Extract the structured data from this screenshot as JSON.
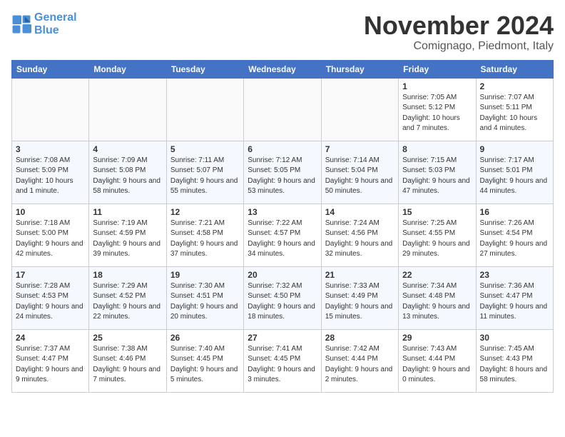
{
  "header": {
    "logo_text_general": "General",
    "logo_text_blue": "Blue",
    "month_title": "November 2024",
    "location": "Comignago, Piedmont, Italy"
  },
  "calendar": {
    "days_of_week": [
      "Sunday",
      "Monday",
      "Tuesday",
      "Wednesday",
      "Thursday",
      "Friday",
      "Saturday"
    ],
    "weeks": [
      [
        {
          "day": "",
          "info": ""
        },
        {
          "day": "",
          "info": ""
        },
        {
          "day": "",
          "info": ""
        },
        {
          "day": "",
          "info": ""
        },
        {
          "day": "",
          "info": ""
        },
        {
          "day": "1",
          "info": "Sunrise: 7:05 AM\nSunset: 5:12 PM\nDaylight: 10 hours and 7 minutes."
        },
        {
          "day": "2",
          "info": "Sunrise: 7:07 AM\nSunset: 5:11 PM\nDaylight: 10 hours and 4 minutes."
        }
      ],
      [
        {
          "day": "3",
          "info": "Sunrise: 7:08 AM\nSunset: 5:09 PM\nDaylight: 10 hours and 1 minute."
        },
        {
          "day": "4",
          "info": "Sunrise: 7:09 AM\nSunset: 5:08 PM\nDaylight: 9 hours and 58 minutes."
        },
        {
          "day": "5",
          "info": "Sunrise: 7:11 AM\nSunset: 5:07 PM\nDaylight: 9 hours and 55 minutes."
        },
        {
          "day": "6",
          "info": "Sunrise: 7:12 AM\nSunset: 5:05 PM\nDaylight: 9 hours and 53 minutes."
        },
        {
          "day": "7",
          "info": "Sunrise: 7:14 AM\nSunset: 5:04 PM\nDaylight: 9 hours and 50 minutes."
        },
        {
          "day": "8",
          "info": "Sunrise: 7:15 AM\nSunset: 5:03 PM\nDaylight: 9 hours and 47 minutes."
        },
        {
          "day": "9",
          "info": "Sunrise: 7:17 AM\nSunset: 5:01 PM\nDaylight: 9 hours and 44 minutes."
        }
      ],
      [
        {
          "day": "10",
          "info": "Sunrise: 7:18 AM\nSunset: 5:00 PM\nDaylight: 9 hours and 42 minutes."
        },
        {
          "day": "11",
          "info": "Sunrise: 7:19 AM\nSunset: 4:59 PM\nDaylight: 9 hours and 39 minutes."
        },
        {
          "day": "12",
          "info": "Sunrise: 7:21 AM\nSunset: 4:58 PM\nDaylight: 9 hours and 37 minutes."
        },
        {
          "day": "13",
          "info": "Sunrise: 7:22 AM\nSunset: 4:57 PM\nDaylight: 9 hours and 34 minutes."
        },
        {
          "day": "14",
          "info": "Sunrise: 7:24 AM\nSunset: 4:56 PM\nDaylight: 9 hours and 32 minutes."
        },
        {
          "day": "15",
          "info": "Sunrise: 7:25 AM\nSunset: 4:55 PM\nDaylight: 9 hours and 29 minutes."
        },
        {
          "day": "16",
          "info": "Sunrise: 7:26 AM\nSunset: 4:54 PM\nDaylight: 9 hours and 27 minutes."
        }
      ],
      [
        {
          "day": "17",
          "info": "Sunrise: 7:28 AM\nSunset: 4:53 PM\nDaylight: 9 hours and 24 minutes."
        },
        {
          "day": "18",
          "info": "Sunrise: 7:29 AM\nSunset: 4:52 PM\nDaylight: 9 hours and 22 minutes."
        },
        {
          "day": "19",
          "info": "Sunrise: 7:30 AM\nSunset: 4:51 PM\nDaylight: 9 hours and 20 minutes."
        },
        {
          "day": "20",
          "info": "Sunrise: 7:32 AM\nSunset: 4:50 PM\nDaylight: 9 hours and 18 minutes."
        },
        {
          "day": "21",
          "info": "Sunrise: 7:33 AM\nSunset: 4:49 PM\nDaylight: 9 hours and 15 minutes."
        },
        {
          "day": "22",
          "info": "Sunrise: 7:34 AM\nSunset: 4:48 PM\nDaylight: 9 hours and 13 minutes."
        },
        {
          "day": "23",
          "info": "Sunrise: 7:36 AM\nSunset: 4:47 PM\nDaylight: 9 hours and 11 minutes."
        }
      ],
      [
        {
          "day": "24",
          "info": "Sunrise: 7:37 AM\nSunset: 4:47 PM\nDaylight: 9 hours and 9 minutes."
        },
        {
          "day": "25",
          "info": "Sunrise: 7:38 AM\nSunset: 4:46 PM\nDaylight: 9 hours and 7 minutes."
        },
        {
          "day": "26",
          "info": "Sunrise: 7:40 AM\nSunset: 4:45 PM\nDaylight: 9 hours and 5 minutes."
        },
        {
          "day": "27",
          "info": "Sunrise: 7:41 AM\nSunset: 4:45 PM\nDaylight: 9 hours and 3 minutes."
        },
        {
          "day": "28",
          "info": "Sunrise: 7:42 AM\nSunset: 4:44 PM\nDaylight: 9 hours and 2 minutes."
        },
        {
          "day": "29",
          "info": "Sunrise: 7:43 AM\nSunset: 4:44 PM\nDaylight: 9 hours and 0 minutes."
        },
        {
          "day": "30",
          "info": "Sunrise: 7:45 AM\nSunset: 4:43 PM\nDaylight: 8 hours and 58 minutes."
        }
      ]
    ]
  }
}
